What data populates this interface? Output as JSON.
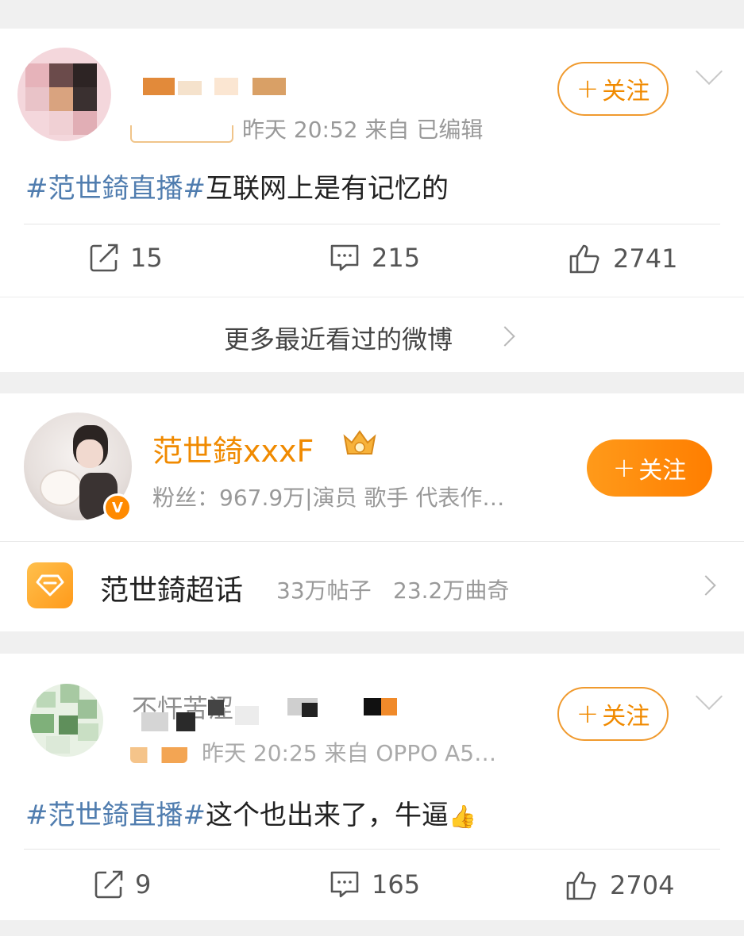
{
  "post1": {
    "meta_text": "昨天 20:52  来自        已编辑",
    "topic": "#范世錡直播#",
    "text": "互联网上是有记忆的",
    "follow_label": "关注",
    "repost_count": "15",
    "comment_count": "215",
    "like_count": "2741"
  },
  "more_recent": {
    "label": "更多最近看过的微博"
  },
  "profile": {
    "name": "范世錡xxxF",
    "desc": "粉丝：967.9万|演员 歌手 代表作…",
    "follow_label": "关注",
    "verified_badge": "V"
  },
  "supertopic": {
    "title": "范世錡超话",
    "posts": "33万帖子",
    "cookies": "23.2万曲奇"
  },
  "post2": {
    "username_partial": "不忓苦涩",
    "meta_text": "昨天 20:25  来自 OPPO A5…",
    "topic": "#范世錡直播#",
    "text": "这个也出来了，牛逼",
    "emoji": "👍",
    "follow_label": "关注",
    "repost_count": "9",
    "comment_count": "165",
    "like_count": "2704"
  },
  "colors": {
    "accent": "#ff8200",
    "topic": "#507daf",
    "separator": "#f0f0f0"
  }
}
